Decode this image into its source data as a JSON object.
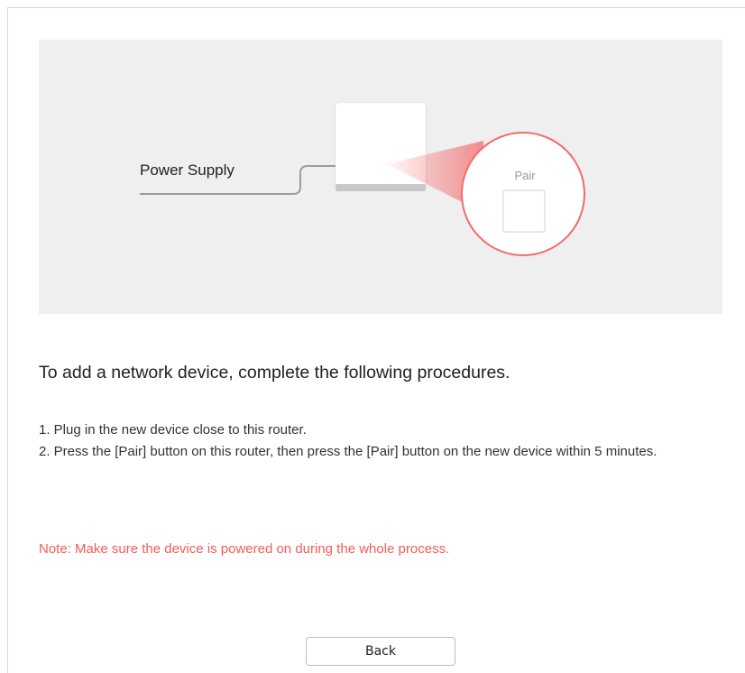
{
  "illustration": {
    "power_supply_label": "Power Supply",
    "pair_label": "Pair"
  },
  "instructions": {
    "heading": "To add a network device, complete the following procedures.",
    "steps": [
      "1. Plug in the new device close to this router.",
      "2. Press the [Pair] button on this router, then press the [Pair] button on the new device within 5 minutes."
    ],
    "note": "Note: Make sure the device is powered on during the whole process."
  },
  "actions": {
    "back_label": "Back"
  },
  "colors": {
    "note": "#f45b5b",
    "highlight_ring": "#f36b6b",
    "illustration_bg": "#efefef"
  }
}
